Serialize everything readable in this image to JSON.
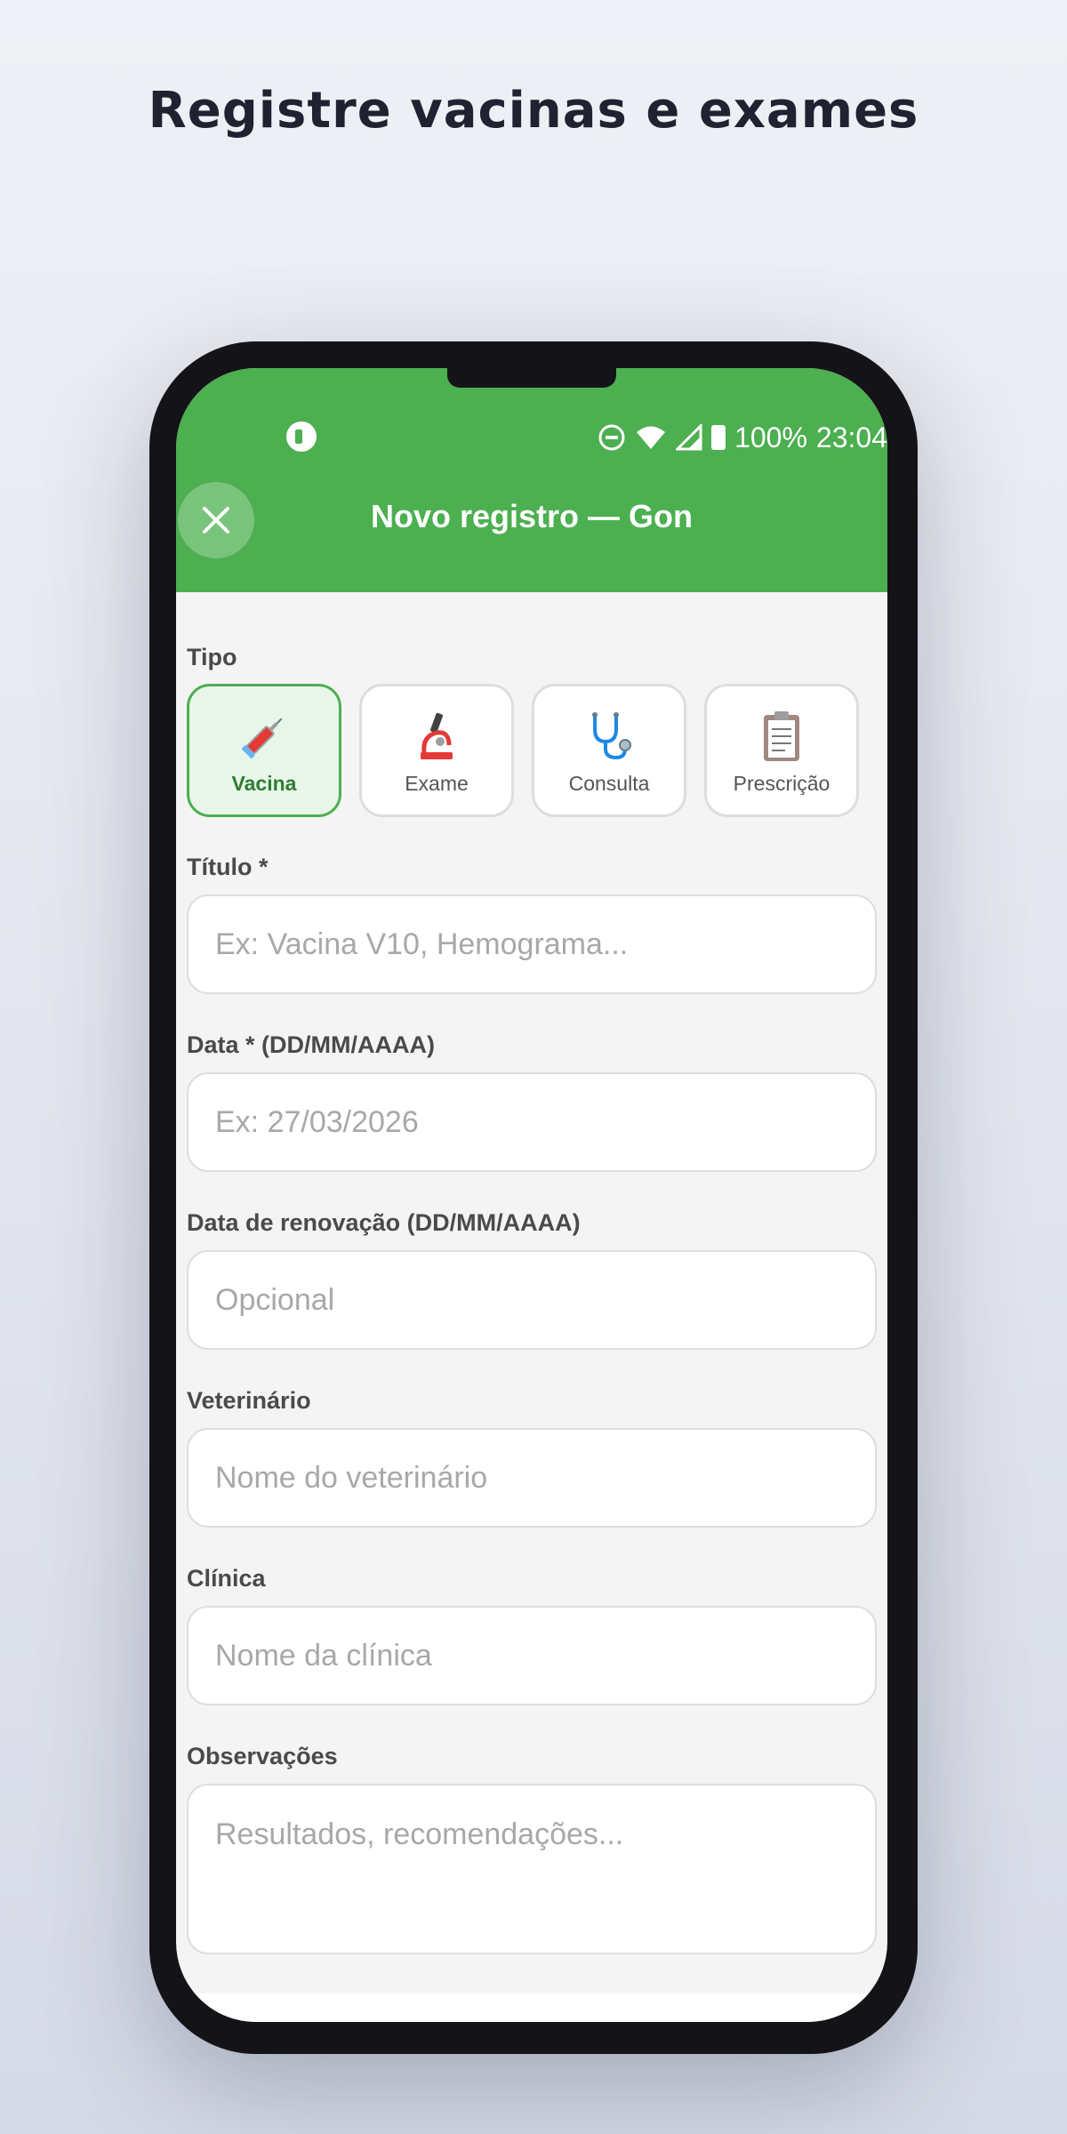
{
  "headline": "Registre vacinas e exames",
  "status_bar": {
    "battery": "100%",
    "time": "23:04",
    "icons": [
      "app-notification-icon",
      "do-not-disturb-icon",
      "wifi-icon",
      "signal-icon",
      "battery-icon"
    ]
  },
  "app_bar": {
    "close_icon": "close-icon",
    "title": "Novo registro — Gon"
  },
  "form": {
    "type_label": "Tipo",
    "types": [
      {
        "label": "Vacina",
        "icon": "syringe-icon",
        "selected": true
      },
      {
        "label": "Exame",
        "icon": "microscope-icon",
        "selected": false
      },
      {
        "label": "Consulta",
        "icon": "stethoscope-icon",
        "selected": false
      },
      {
        "label": "Prescrição",
        "icon": "clipboard-icon",
        "selected": false
      }
    ],
    "title_label": "Título *",
    "title_placeholder": "Ex: Vacina V10, Hemograma...",
    "date_label": "Data * (DD/MM/AAAA)",
    "date_placeholder": "Ex: 27/03/2026",
    "renewal_label": "Data de renovação (DD/MM/AAAA)",
    "renewal_placeholder": "Opcional",
    "vet_label": "Veterinário",
    "vet_placeholder": "Nome do veterinário",
    "clinic_label": "Clínica",
    "clinic_placeholder": "Nome da clínica",
    "notes_label": "Observações",
    "notes_placeholder": "Resultados, recomendações..."
  },
  "colors": {
    "primary": "#4caf50",
    "primary_dark": "#2e7d32",
    "selected_bg": "#e8f5e9"
  }
}
